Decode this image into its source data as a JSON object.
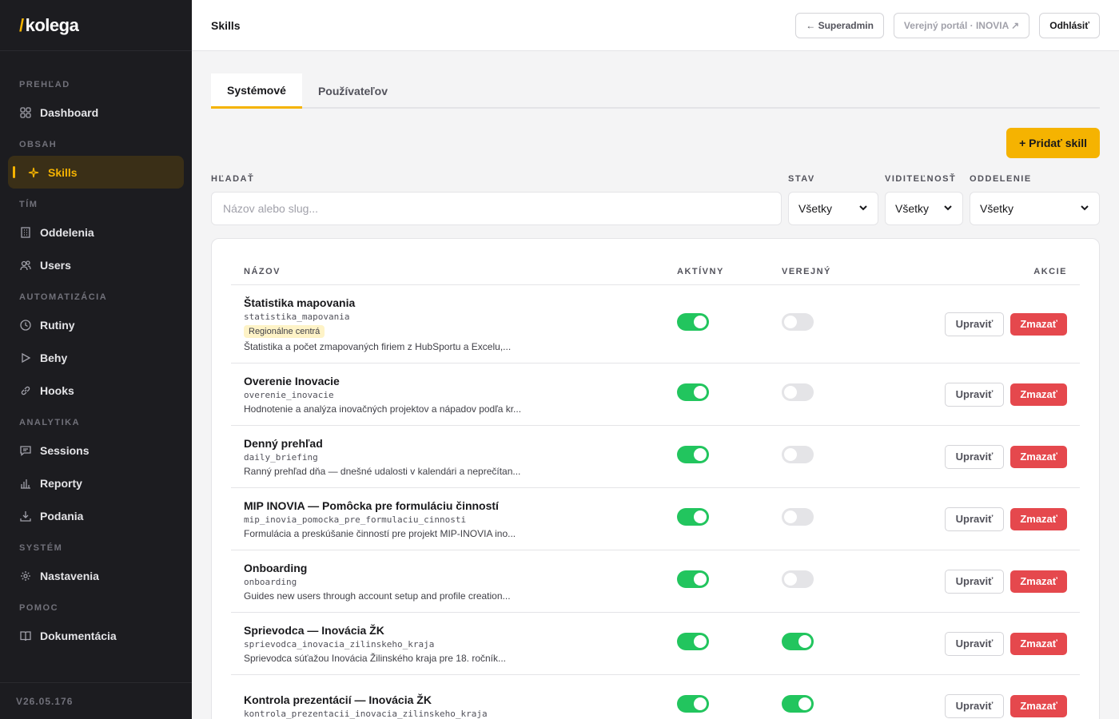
{
  "brand": {
    "slash": "/",
    "name": "kolega"
  },
  "sidebar": {
    "sections": [
      {
        "title": "PREHĽAD",
        "items": [
          {
            "label": "Dashboard",
            "icon": "grid-icon"
          }
        ]
      },
      {
        "title": "OBSAH",
        "items": [
          {
            "label": "Skills",
            "icon": "sparkle-icon",
            "active": true
          }
        ]
      },
      {
        "title": "TÍM",
        "items": [
          {
            "label": "Oddelenia",
            "icon": "building-icon"
          },
          {
            "label": "Users",
            "icon": "users-icon"
          }
        ]
      },
      {
        "title": "AUTOMATIZÁCIA",
        "items": [
          {
            "label": "Rutiny",
            "icon": "clock-icon"
          },
          {
            "label": "Behy",
            "icon": "play-icon"
          },
          {
            "label": "Hooks",
            "icon": "link-icon"
          }
        ]
      },
      {
        "title": "ANALYTIKA",
        "items": [
          {
            "label": "Sessions",
            "icon": "chat-icon"
          },
          {
            "label": "Reporty",
            "icon": "bar-chart-icon"
          },
          {
            "label": "Podania",
            "icon": "download-icon"
          }
        ]
      },
      {
        "title": "SYSTÉM",
        "items": [
          {
            "label": "Nastavenia",
            "icon": "gear-icon"
          }
        ]
      },
      {
        "title": "POMOC",
        "items": [
          {
            "label": "Dokumentácia",
            "icon": "book-icon"
          }
        ]
      }
    ],
    "version": "V26.05.176"
  },
  "header": {
    "title": "Skills",
    "superadmin": "← Superadmin",
    "portal": "Verejný portál · INOVIA ↗",
    "logout": "Odhlásiť"
  },
  "tabs": [
    {
      "label": "Systémové",
      "active": true
    },
    {
      "label": "Používateľov",
      "active": false
    }
  ],
  "add_button": "+ Pridať skill",
  "filters": {
    "search_label": "HĽADAŤ",
    "search_placeholder": "Názov alebo slug...",
    "status_label": "STAV",
    "status_value": "Všetky",
    "visibility_label": "VIDITEĽNOSŤ",
    "visibility_value": "Všetky",
    "department_label": "ODDELENIE",
    "department_value": "Všetky"
  },
  "table": {
    "headers": {
      "name": "NÁZOV",
      "active": "AKTÍVNY",
      "public": "VEREJNÝ",
      "actions": "AKCIE"
    },
    "edit_label": "Upraviť",
    "delete_label": "Zmazať",
    "rows": [
      {
        "name": "Štatistika mapovania",
        "slug": "statistika_mapovania",
        "badge": "Regionálne centrá",
        "desc": "Štatistika a počet zmapovaných firiem z HubSportu a Excelu,...",
        "active": true,
        "public": false
      },
      {
        "name": "Overenie Inovacie",
        "slug": "overenie_inovacie",
        "desc": "Hodnotenie a analýza inovačných projektov a nápadov podľa kr...",
        "active": true,
        "public": false
      },
      {
        "name": "Denný prehľad",
        "slug": "daily_briefing",
        "desc": "Ranný prehľad dňa — dnešné udalosti v kalendári a neprečítan...",
        "active": true,
        "public": false
      },
      {
        "name": "MIP INOVIA — Pomôcka pre formuláciu činností",
        "slug": "mip_inovia_pomocka_pre_formulaciu_cinnosti",
        "desc": "Formulácia a preskúšanie činností pre projekt MIP-INOVIA ino...",
        "active": true,
        "public": false
      },
      {
        "name": "Onboarding",
        "slug": "onboarding",
        "desc": "Guides new users through account setup and profile creation...",
        "active": true,
        "public": false
      },
      {
        "name": "Sprievodca — Inovácia ŽK",
        "slug": "sprievodca_inovacia_zilinskeho_kraja",
        "desc": "Sprievodca súťažou Inovácia Žilinského kraja pre 18. ročník...",
        "active": true,
        "public": true
      },
      {
        "name": "Kontrola prezentácií — Inovácia ŽK",
        "slug": "kontrola_prezentacii_inovacia_zilinskeho_kraja",
        "desc": "",
        "active": true,
        "public": true
      }
    ]
  }
}
